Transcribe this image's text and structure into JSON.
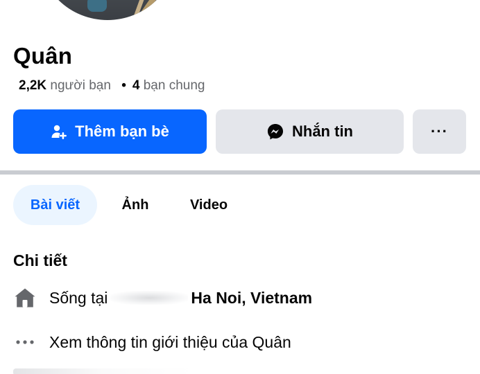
{
  "profile": {
    "name": "Quân",
    "friends_count": "2,2K",
    "friends_label": "người bạn",
    "separator": "•",
    "mutual_count": "4",
    "mutual_label": "bạn chung"
  },
  "actions": {
    "add_friend_label": "Thêm bạn bè",
    "message_label": "Nhắn tin",
    "more_label": "···"
  },
  "tabs": [
    {
      "label": "Bài viết",
      "active": true
    },
    {
      "label": "Ảnh",
      "active": false
    },
    {
      "label": "Video",
      "active": false
    }
  ],
  "details": {
    "title": "Chi tiết",
    "lives_in_prefix": "Sống tại",
    "lives_in_place": "Ha Noi, Vietnam",
    "about_link": "Xem thông tin giới thiệu của Quân"
  },
  "icons": {
    "add_friend": "person-plus-icon",
    "message": "messenger-icon",
    "home": "house-icon",
    "more": "more-dots-icon"
  },
  "colors": {
    "primary": "#0866ff",
    "secondary_bg": "#e4e6eb",
    "active_tab_bg": "#ebf5ff",
    "text_secondary": "#65676b"
  }
}
